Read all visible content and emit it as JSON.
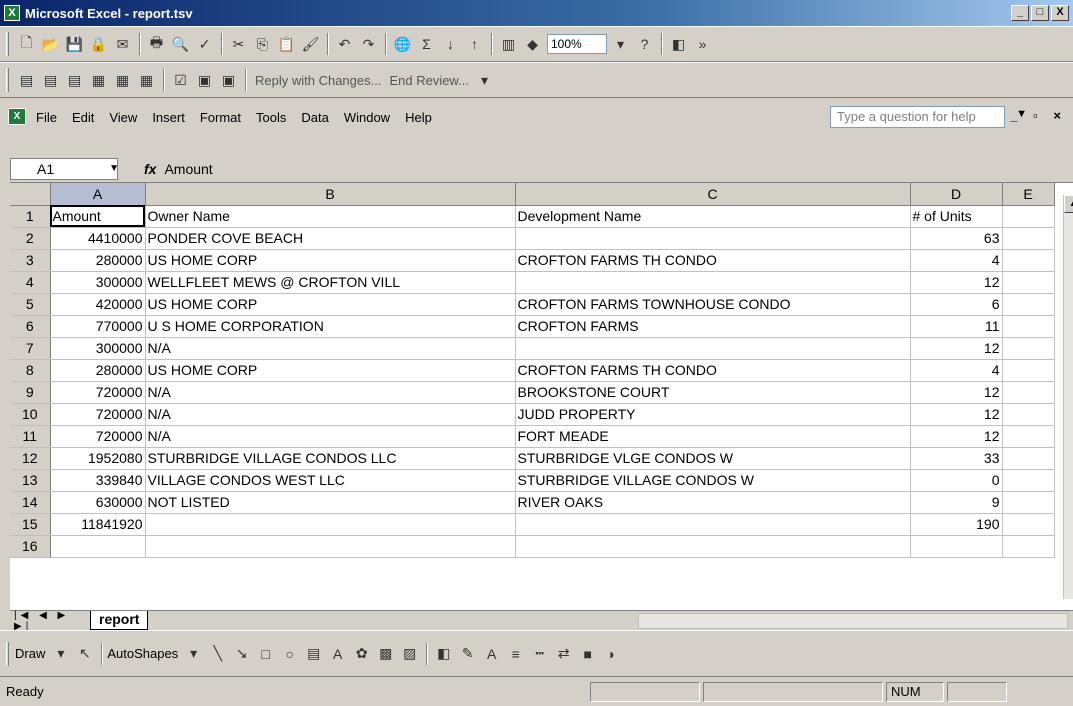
{
  "window": {
    "title": "Microsoft Excel - report.tsv",
    "app_icon": "X",
    "min": "_",
    "max": "□",
    "close": "X"
  },
  "toolbar": {
    "zoom": "100%",
    "reply_label": "Reply with Changes...",
    "end_review_label": "End Review..."
  },
  "menu": {
    "items": [
      "File",
      "Edit",
      "View",
      "Insert",
      "Format",
      "Tools",
      "Data",
      "Window",
      "Help"
    ],
    "help_placeholder": "Type a question for help"
  },
  "formula": {
    "name_box": "A1",
    "fx": "fx",
    "value": "Amount"
  },
  "grid": {
    "columns": [
      "A",
      "B",
      "C",
      "D",
      "E"
    ],
    "rows": [
      {
        "n": "1",
        "a": "Amount",
        "b": "Owner Name",
        "c": "Development Name",
        "d": "# of Units"
      },
      {
        "n": "2",
        "a": "4410000",
        "b": "PONDER COVE BEACH",
        "c": "",
        "d": "63"
      },
      {
        "n": "3",
        "a": "280000",
        "b": "US HOME CORP",
        "c": "CROFTON FARMS TH CONDO",
        "d": "4"
      },
      {
        "n": "4",
        "a": "300000",
        "b": "WELLFLEET MEWS @ CROFTON VILL",
        "c": "",
        "d": "12"
      },
      {
        "n": "5",
        "a": "420000",
        "b": "US HOME CORP",
        "c": "CROFTON FARMS TOWNHOUSE CONDO",
        "d": "6"
      },
      {
        "n": "6",
        "a": "770000",
        "b": "U S HOME CORPORATION",
        "c": "CROFTON FARMS",
        "d": "11"
      },
      {
        "n": "7",
        "a": "300000",
        "b": "N/A",
        "c": "",
        "d": "12"
      },
      {
        "n": "8",
        "a": "280000",
        "b": "US HOME CORP",
        "c": "CROFTON FARMS TH CONDO",
        "d": "4"
      },
      {
        "n": "9",
        "a": "720000",
        "b": "N/A",
        "c": "BROOKSTONE COURT",
        "d": "12"
      },
      {
        "n": "10",
        "a": "720000",
        "b": "N/A",
        "c": "JUDD PROPERTY",
        "d": "12"
      },
      {
        "n": "11",
        "a": "720000",
        "b": "N/A",
        "c": "FORT MEADE",
        "d": "12"
      },
      {
        "n": "12",
        "a": "1952080",
        "b": "STURBRIDGE VILLAGE CONDOS LLC",
        "c": "STURBRIDGE VLGE CONDOS W",
        "d": "33"
      },
      {
        "n": "13",
        "a": "339840",
        "b": "VILLAGE CONDOS WEST LLC",
        "c": "STURBRIDGE VILLAGE CONDOS W",
        "d": "0"
      },
      {
        "n": "14",
        "a": "630000",
        "b": "NOT LISTED",
        "c": "RIVER OAKS",
        "d": "9"
      },
      {
        "n": "15",
        "a": "11841920",
        "b": "",
        "c": "",
        "d": "190"
      },
      {
        "n": "16",
        "a": "",
        "b": "",
        "c": "",
        "d": ""
      }
    ]
  },
  "sheets": {
    "active": "report"
  },
  "drawing": {
    "draw_label": "Draw",
    "autoshapes_label": "AutoShapes"
  },
  "status": {
    "text": "Ready",
    "num": "NUM"
  }
}
